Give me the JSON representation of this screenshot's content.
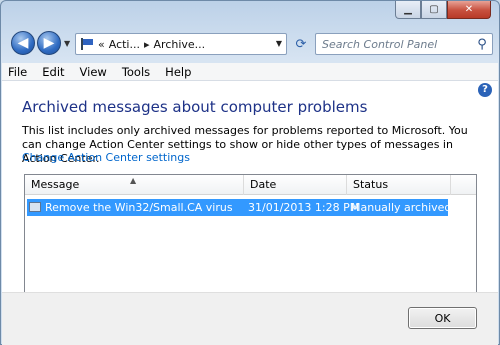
{
  "window": {
    "caption_buttons": {
      "minimize": "▁",
      "maximize": "▢",
      "close": "✕"
    }
  },
  "navbar": {
    "breadcrumb_prefix": "«",
    "crumbs": [
      "Acti...",
      "Archive..."
    ],
    "separator": "▸",
    "search_placeholder": "Search Control Panel"
  },
  "menubar": {
    "items": [
      "File",
      "Edit",
      "View",
      "Tools",
      "Help"
    ]
  },
  "main": {
    "heading": "Archived messages about computer problems",
    "description": "This list includes only archived messages for problems reported to Microsoft. You can change Action Center settings to show or hide other types of messages in Action Center.",
    "link": "Change Action Center settings",
    "table": {
      "columns": [
        "Message",
        "Date",
        "Status"
      ],
      "rows": [
        {
          "message": "Remove the Win32/Small.CA virus",
          "date": "31/01/2013 1:28 PM",
          "status": "Manually archived",
          "selected": true
        }
      ]
    }
  },
  "footer": {
    "ok_label": "OK"
  },
  "colors": {
    "heading": "#1e3287",
    "link": "#0066cc",
    "selection": "#3399ff"
  }
}
